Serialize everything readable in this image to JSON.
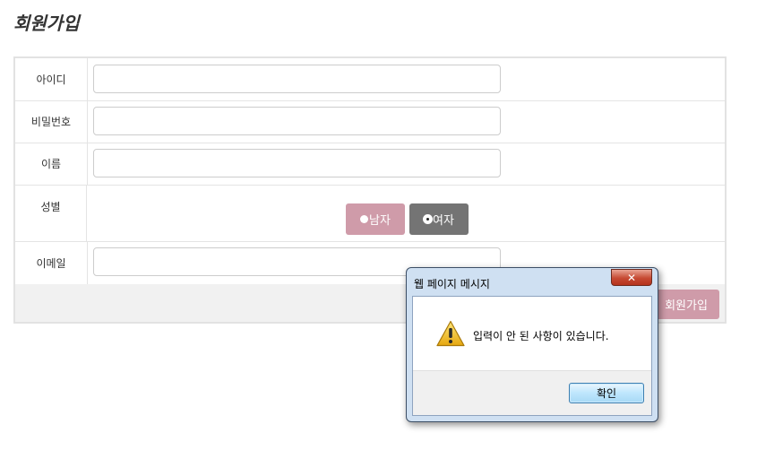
{
  "page": {
    "title": "회원가입"
  },
  "form": {
    "id_label": "아이디",
    "password_label": "비밀번호",
    "name_label": "이름",
    "gender_label": "성별",
    "email_label": "이메일",
    "id_value": "",
    "password_value": "",
    "name_value": "",
    "email_value": "",
    "gender_options": [
      "남자",
      "여자"
    ],
    "gender_selected": "여자",
    "submit_label": "회원가입",
    "colors": {
      "accent": "#cf9ba9",
      "selected": "#747474"
    }
  },
  "dialog": {
    "title": "웹 페이지 메시지",
    "close_symbol": "✕",
    "icon": "warning-icon",
    "message": "입력이 안 된 사항이 있습니다.",
    "ok_label": "확인"
  }
}
